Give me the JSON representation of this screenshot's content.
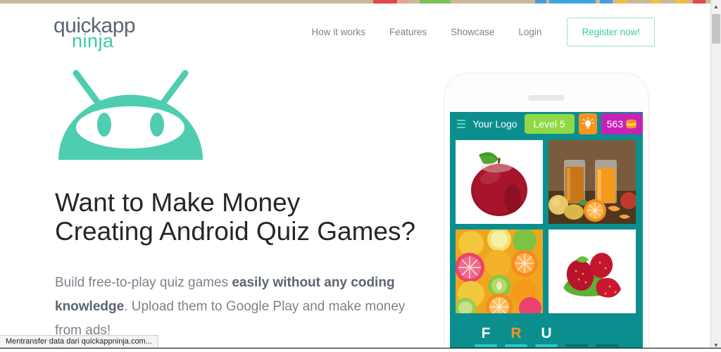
{
  "browser": {
    "status_text": "Mentransfer data dari quickappninja.com...",
    "scroll_up_icon": "chevron-up-icon",
    "scroll_down_icon": "chevron-down-icon"
  },
  "header": {
    "logo": {
      "line1": "quickapp",
      "line2": "ninja",
      "color1": "#5b6472",
      "color2": "#3dc8a8"
    },
    "nav": [
      {
        "label": "How it works"
      },
      {
        "label": "Features"
      },
      {
        "label": "Showcase"
      },
      {
        "label": "Login"
      }
    ],
    "cta": {
      "label": "Register now!",
      "text_color": "#3dc8a8",
      "border_color": "#9fe0cf"
    }
  },
  "hero": {
    "mascot_icon": "android-robot-head-icon",
    "mascot_color": "#4ecdb0",
    "title_line1": "Want to Make Money",
    "title_line2": "Creating Android Quiz Games?",
    "subtitle_part1": "Build free-to-play quiz games ",
    "subtitle_bold1": "easily without any coding knowledge",
    "subtitle_part2": ". Upload them to Google Play and make money from ads!"
  },
  "phone": {
    "app_bar": {
      "menu_icon": "hamburger-menu-icon",
      "logo_text": "Your Logo",
      "level_label": "Level 5",
      "level_color": "#8fd944",
      "hint_icon": "lightbulb-icon",
      "hint_color": "#f7941d",
      "coins_value": "563",
      "coins_icon": "coin-stack-icon",
      "coins_color": "#c622b8"
    },
    "pictures": [
      {
        "name": "red-apple-photo",
        "alt": "Red apple with leaf on white background"
      },
      {
        "name": "fruit-juice-photo",
        "alt": "Two glasses of fruit juice with oranges and apples"
      },
      {
        "name": "citrus-collage-photo",
        "alt": "Sliced citrus fruits, kiwi and grapefruit"
      },
      {
        "name": "strawberries-photo",
        "alt": "Strawberries on green leaves"
      }
    ],
    "answer_slots": [
      {
        "letter": "F",
        "state": "filled-white"
      },
      {
        "letter": "R",
        "state": "filled-orange"
      },
      {
        "letter": "U",
        "state": "filled-white"
      },
      {
        "letter": "",
        "state": "empty"
      },
      {
        "letter": "",
        "state": "empty"
      }
    ]
  }
}
